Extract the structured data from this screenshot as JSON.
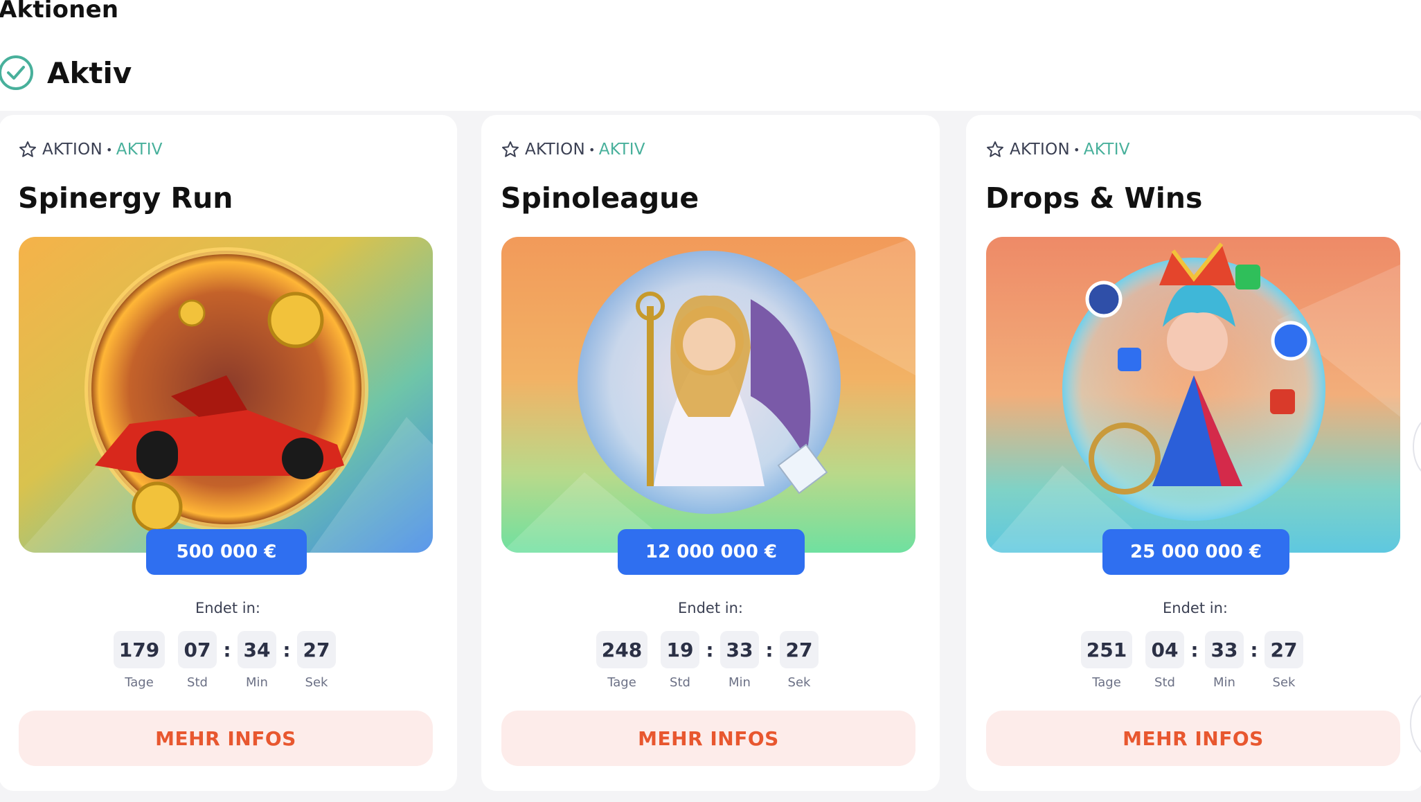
{
  "page": {
    "title": "Aktionen"
  },
  "section": {
    "label": "Aktiv",
    "icon": "check-circle-icon"
  },
  "colors": {
    "accent_blue": "#2f6ff0",
    "status_green": "#48b09b",
    "cta_text": "#e8572f",
    "cta_bg": "#fdecea"
  },
  "cards": [
    {
      "tag": "AKTION",
      "status": "AKTIV",
      "title": "Spinergy Run",
      "image": "race-car-coin-bubble",
      "prize": "500 000 €",
      "ends_label": "Endet in:",
      "countdown": {
        "days": "179",
        "hours": "07",
        "minutes": "34",
        "seconds": "27",
        "days_label": "Tage",
        "hours_label": "Std",
        "minutes_label": "Min",
        "seconds_label": "Sek"
      },
      "cta": "MEHR INFOS"
    },
    {
      "tag": "AKTION",
      "status": "AKTIV",
      "title": "Spinoleague",
      "image": "goddess-angel-bubble",
      "prize": "12 000 000 €",
      "ends_label": "Endet in:",
      "countdown": {
        "days": "248",
        "hours": "19",
        "minutes": "33",
        "seconds": "27",
        "days_label": "Tage",
        "hours_label": "Std",
        "minutes_label": "Min",
        "seconds_label": "Sek"
      },
      "cta": "MEHR INFOS"
    },
    {
      "tag": "AKTION",
      "status": "AKTIV",
      "title": "Drops & Wins",
      "image": "jester-girl-bubble",
      "prize": "25 000 000 €",
      "ends_label": "Endet in:",
      "countdown": {
        "days": "251",
        "hours": "04",
        "minutes": "33",
        "seconds": "27",
        "days_label": "Tage",
        "hours_label": "Std",
        "minutes_label": "Min",
        "seconds_label": "Sek"
      },
      "cta": "MEHR INFOS"
    }
  ]
}
